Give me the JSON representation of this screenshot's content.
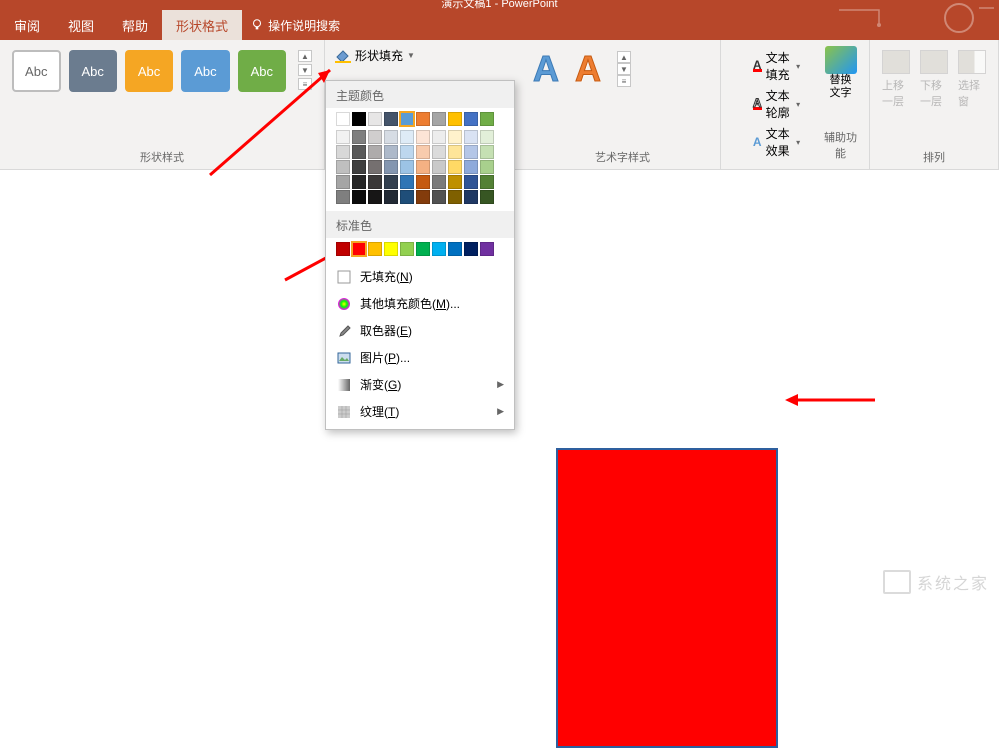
{
  "title": "演示文稿1 - PowerPoint",
  "tabs": {
    "review": "审阅",
    "view": "视图",
    "help": "帮助",
    "shape_format": "形状格式",
    "search_hint": "操作说明搜索"
  },
  "ribbon": {
    "shape_styles_label": "形状样式",
    "style_text": "Abc",
    "fill_btn": "形状填充",
    "wordart_label": "艺术字样式",
    "wordart_a": "A",
    "text_fill": "文本填充",
    "text_outline": "文本轮廓",
    "text_effects": "文本效果",
    "accessibility_label": "辅助功能",
    "replace_text_line1": "替换",
    "replace_text_line2": "文字",
    "arrange_label": "排列",
    "bring_forward": "上移一层",
    "send_backward": "下移一层",
    "selection_pane": "选择窗"
  },
  "fill_menu": {
    "theme_colors": "主题颜色",
    "standard_colors": "标准色",
    "no_fill": "无填充",
    "no_fill_key": "N",
    "more_colors": "其他填充颜色",
    "more_colors_key": "M",
    "eyedropper": "取色器",
    "eyedropper_key": "E",
    "picture": "图片",
    "picture_key": "P",
    "gradient": "渐变",
    "gradient_key": "G",
    "texture": "纹理",
    "texture_key": "T",
    "theme_row1": [
      "#ffffff",
      "#000000",
      "#e7e6e6",
      "#44546a",
      "#5b9bd5",
      "#ed7d31",
      "#a5a5a5",
      "#ffc000",
      "#4472c4",
      "#70ad47"
    ],
    "theme_shades": [
      [
        "#f2f2f2",
        "#7f7f7f",
        "#d0cece",
        "#d6dce4",
        "#deebf6",
        "#fce4d6",
        "#ededed",
        "#fff2cc",
        "#d9e2f3",
        "#e2efd9"
      ],
      [
        "#d8d8d8",
        "#595959",
        "#aeabab",
        "#adb9ca",
        "#bdd7ee",
        "#f8cbad",
        "#dbdbdb",
        "#fee599",
        "#b4c6e7",
        "#c5e0b3"
      ],
      [
        "#bfbfbf",
        "#3f3f3f",
        "#757070",
        "#8496b0",
        "#9cc3e5",
        "#f4b183",
        "#c9c9c9",
        "#ffd965",
        "#8eaadb",
        "#a8d08d"
      ],
      [
        "#a5a5a5",
        "#262626",
        "#3a3838",
        "#323f4f",
        "#2f75b5",
        "#c55a11",
        "#7b7b7b",
        "#bf9000",
        "#2f5496",
        "#538135"
      ],
      [
        "#7f7f7f",
        "#0c0c0c",
        "#171616",
        "#222a35",
        "#1f4e79",
        "#833c0c",
        "#525252",
        "#7f6000",
        "#1f3864",
        "#375623"
      ]
    ],
    "standard_row": [
      "#c00000",
      "#ff0000",
      "#ffc000",
      "#ffff00",
      "#92d050",
      "#00b050",
      "#00b0f0",
      "#0070c0",
      "#002060",
      "#7030a0"
    ],
    "selected_theme": 4,
    "selected_standard": 1
  },
  "watermark": "系统之家"
}
